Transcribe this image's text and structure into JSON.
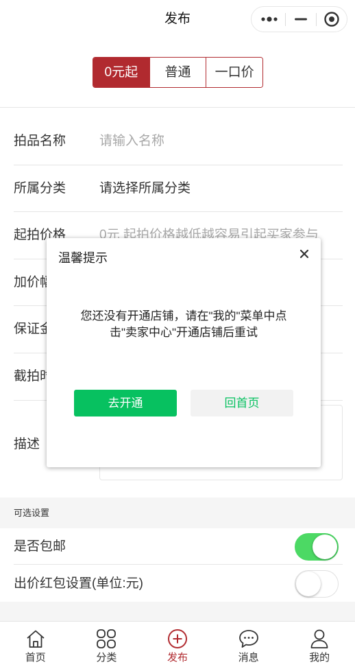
{
  "nav": {
    "title": "发布"
  },
  "price_mode": {
    "tabs": [
      {
        "label": "0元起",
        "selected": true
      },
      {
        "label": "普通",
        "selected": false
      },
      {
        "label": "一口价",
        "selected": false
      }
    ]
  },
  "form": {
    "name": {
      "label": "拍品名称",
      "placeholder": "请输入名称"
    },
    "category": {
      "label": "所属分类",
      "value": "请选择所属分类"
    },
    "start_price": {
      "label": "起拍价格",
      "placeholder": "0元 起拍价格越低越容易引起买家参与"
    },
    "increment": {
      "label": "加价幅"
    },
    "deposit": {
      "label": "保证金"
    },
    "end_time": {
      "label": "截拍时"
    },
    "description": {
      "label": "描述"
    }
  },
  "optional": {
    "section_title": "可选设置",
    "free_shipping": {
      "label": "是否包邮",
      "on": true
    },
    "bid_red_packet": {
      "label": "出价红包设置(单位:元)",
      "on": false
    }
  },
  "modal": {
    "title": "温馨提示",
    "message_lines": [
      "您还没有开通店铺，请在\"我的\"菜单中点",
      "击\"卖家中心\"开通店铺后重试"
    ],
    "confirm_label": "去开通",
    "cancel_label": "回首页"
  },
  "tabbar": {
    "items": [
      {
        "label": "首页",
        "icon": "home-icon",
        "active": false
      },
      {
        "label": "分类",
        "icon": "grid-icon",
        "active": false
      },
      {
        "label": "发布",
        "icon": "plus-circle-icon",
        "active": true
      },
      {
        "label": "消息",
        "icon": "chat-bubble-icon",
        "active": false
      },
      {
        "label": "我的",
        "icon": "user-icon",
        "active": false
      }
    ]
  },
  "colors": {
    "brand_red": "#b12a2f",
    "primary_green": "#07c160",
    "toggle_on": "#4cd964"
  }
}
